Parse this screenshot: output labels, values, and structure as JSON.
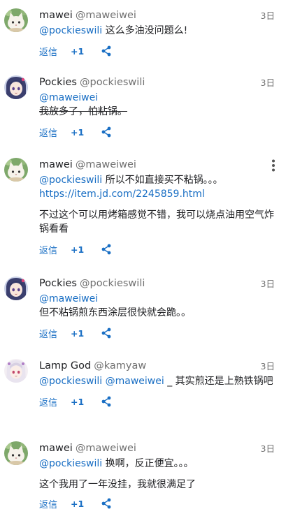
{
  "comments": [
    {
      "author": "mawei",
      "handle": "@maweiwei",
      "date": "3日",
      "avatar": "cat-avatar-icon",
      "mention": "@pockieswili",
      "text": " 这么多油没问题么!",
      "reply": "返信",
      "plus": "+1"
    },
    {
      "author": "Pockies",
      "handle": "@pockieswili",
      "date": "3日",
      "avatar": "anime-girl-avatar-icon",
      "mention": "@maweiwei",
      "text": "我放多了，怕粘锅。",
      "reply": "返信",
      "plus": "+1"
    },
    {
      "author": "mawei",
      "handle": "@maweiwei",
      "date": "3日",
      "avatar": "cat-avatar-icon",
      "mention": "@pockieswili",
      "text": " 所以不如直接买不粘锅。。。",
      "link": "https://item.jd.com/2245859.html",
      "text2": "不过这个可以用烤箱感觉不错，我可以烧点油用空气炸锅看看",
      "reply": "返信",
      "plus": "+1"
    },
    {
      "author": "Pockies",
      "handle": "@pockieswili",
      "date": "3日",
      "avatar": "anime-girl-avatar-icon",
      "mention": "@maweiwei",
      "text": "但不粘锅煎东西涂层很快就会跪。。",
      "reply": "返信",
      "plus": "+1"
    },
    {
      "author": "Lamp God",
      "handle": "@kamyaw",
      "date": "3日",
      "avatar": "anime-girl-pink-avatar-icon",
      "mention": "@pockieswili",
      "mention2": "@maweiwei",
      "text": " _ 其实煎还是上熟铁锅吧",
      "reply": "返信",
      "plus": "+1"
    },
    {
      "author": "mawei",
      "handle": "@maweiwei",
      "date": "3日",
      "avatar": "cat-avatar-icon",
      "mention": "@pockieswili",
      "text": " 换啊，反正便宜。。。",
      "text2": "这个我用了一年没挂，我就很满足了",
      "reply": "返信",
      "plus": "+1"
    }
  ],
  "colors": {
    "link": "#1a6fc4",
    "muted": "#707070",
    "text": "#202124"
  }
}
